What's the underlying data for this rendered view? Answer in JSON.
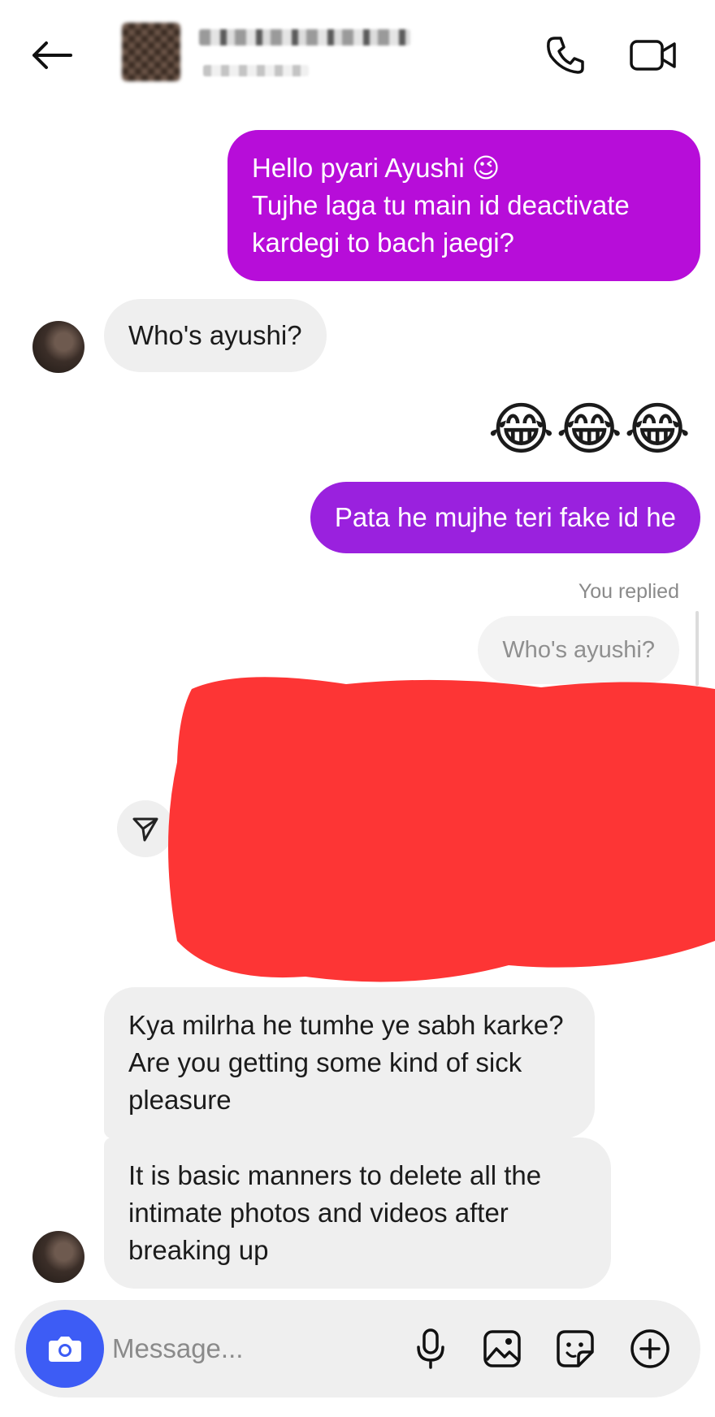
{
  "header": {
    "back_icon": "arrow-left-icon",
    "call_icon": "phone-icon",
    "video_icon": "video-camera-icon"
  },
  "messages": [
    {
      "side": "sent",
      "text": "Hello pyari Ayushi 😉\nTujhe laga tu main id deactivate kardegi to bach jaegi?"
    },
    {
      "side": "received",
      "text": "Who's ayushi?"
    },
    {
      "side": "sent",
      "text": "😂😂😂"
    },
    {
      "side": "sent",
      "text": "Pata he mujhe teri fake id he"
    },
    {
      "side": "sent",
      "reply_label": "You replied",
      "quoted": "Who's ayushi?"
    },
    {
      "side": "received",
      "text": "Kya milrha he tumhe ye sabh karke? Are you getting some kind of sick pleasure"
    },
    {
      "side": "received",
      "text": "It is basic manners to delete all the intimate photos and videos after breaking up"
    }
  ],
  "composer": {
    "placeholder": "Message...",
    "camera_icon": "camera-icon",
    "mic_icon": "microphone-icon",
    "gallery_icon": "image-icon",
    "sticker_icon": "sticker-icon",
    "plus_icon": "plus-circle-icon"
  },
  "colors": {
    "sent_bubble_1": "#b70dd9",
    "sent_bubble_2": "#9a21de",
    "received_bubble": "#efefef",
    "camera_button": "#3d5cf5",
    "redaction": "#fd3535"
  }
}
